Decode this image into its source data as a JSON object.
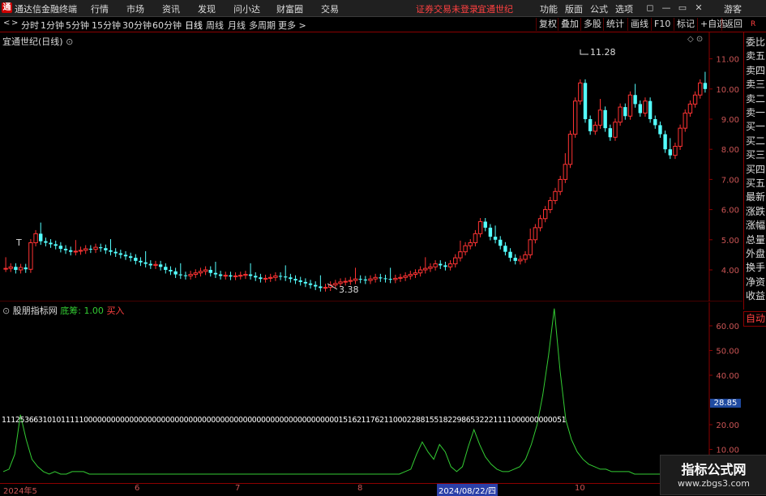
{
  "app": {
    "logo_glyph": "通",
    "title": "通达信金融终端",
    "menu": [
      "行情",
      "市场",
      "资讯",
      "发现",
      "问小达",
      "财富圈",
      "交易"
    ],
    "notice": "证券交易未登录",
    "stock_name_top": "宜通世纪",
    "right_menu": [
      "功能",
      "版面",
      "公式",
      "选项"
    ],
    "window_buttons": [
      "◻",
      "—",
      "▭",
      "✕"
    ],
    "user": "游客"
  },
  "periods": {
    "items": [
      "分时",
      "1分钟",
      "5分钟",
      "15分钟",
      "30分钟",
      "60分钟",
      "日线",
      "周线",
      "月线",
      "多周期",
      "更多 >"
    ],
    "active": "日线"
  },
  "toolbar": [
    "复权",
    "叠加",
    "多股",
    "统计",
    "画线",
    "F10",
    "标记",
    "+自选",
    "返回"
  ],
  "main_chart": {
    "title": "宜通世纪(日线)",
    "high_label": "11.28",
    "low_label": "3.38",
    "y_ticks": [
      "11.00",
      "10.00",
      "9.00",
      "8.00",
      "7.00",
      "6.00",
      "5.00",
      "4.00"
    ],
    "colors": {
      "up": "#ff3333",
      "down": "#54ffff",
      "axis": "#8b0000"
    }
  },
  "indicator": {
    "name": "股朋指标网",
    "label": "底筹:",
    "value": "1.00",
    "signal": "买入",
    "y_ticks": [
      "60.00",
      "50.00",
      "40.00",
      "20.00",
      "10.00"
    ],
    "current_value": "28.85",
    "digits_row": "1112536631010111110000000000000000000000000000000000000000000000000000000015162117621100022881551822986532221111000000000051",
    "line_color": "#33cc33"
  },
  "side_panel": {
    "items": [
      "委比",
      "卖五",
      "卖四",
      "卖三",
      "卖二",
      "卖一",
      "买一",
      "买二",
      "买三",
      "买四",
      "买五",
      "最新",
      "涨跌",
      "涨幅",
      "总量",
      "外盘",
      "换手",
      "净资",
      "收益"
    ],
    "auto": "自动",
    "top_glyph": "R"
  },
  "x_axis": {
    "labels": [
      "2024年5",
      "6",
      "7",
      "8",
      "2024/08/22/四",
      "10"
    ]
  },
  "watermark": {
    "line1": "指标公式网",
    "line2": "www.zbgs3.com"
  }
}
